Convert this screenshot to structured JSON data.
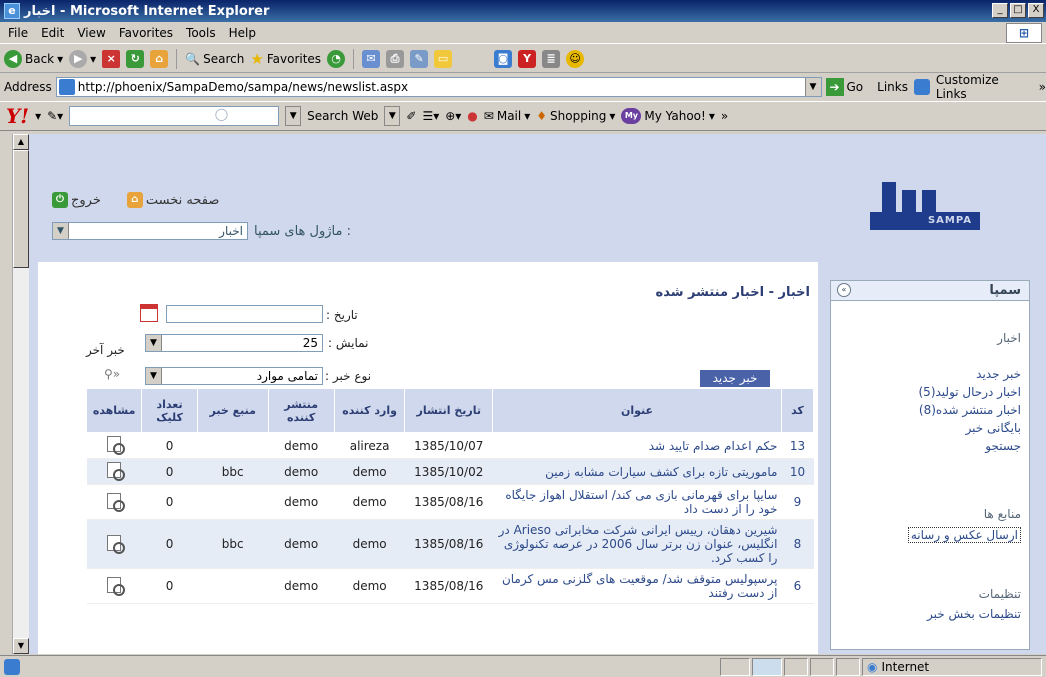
{
  "window": {
    "title": "اخبار - Microsoft Internet Explorer",
    "controls": [
      "_",
      "□",
      "X"
    ]
  },
  "menu": [
    "File",
    "Edit",
    "View",
    "Favorites",
    "Tools",
    "Help"
  ],
  "toolbar": {
    "back": "Back",
    "search": "Search",
    "favorites": "Favorites"
  },
  "address": {
    "label": "Address",
    "url": "http://phoenix/SampaDemo/sampa/news/newslist.aspx",
    "go": "Go",
    "links": "Links",
    "customize": "Customize Links",
    "more": "»"
  },
  "yahoo": {
    "logo": "Y!",
    "search_web": "Search Web",
    "mail": "Mail",
    "shopping": "Shopping",
    "my_yahoo": "My Yahoo!",
    "more": "»"
  },
  "header": {
    "home": "صفحه نخست",
    "logout": "خروج",
    "modules_label": "ماژول های سمپا :",
    "module_selected": "اخبار",
    "logo_text": "SAMPA"
  },
  "main": {
    "page_title": "اخبار - اخبار منتشر شده",
    "date_label": "تاریخ :",
    "show_label": "نمایش :",
    "show_value": "25",
    "last_news": "خبر آخر",
    "type_label": "نوع خبر :",
    "type_value": "تمامی موارد",
    "new_news_button": "خبر جدید"
  },
  "table": {
    "headers": [
      "کد",
      "عنوان",
      "تاریخ انتشار",
      "وارد کننده",
      "منتشر کننده",
      "منبع خبر",
      "تعداد کلیک",
      "مشاهده"
    ],
    "rows": [
      {
        "code": "13",
        "title": "حکم اعدام صدام تایید شد",
        "date": "1385/10/07",
        "entered_by": "alireza",
        "published_by": "demo",
        "source": "",
        "clicks": "0"
      },
      {
        "code": "10",
        "title": "ماموریتی تازه برای کشف سیارات مشابه زمین",
        "date": "1385/10/02",
        "entered_by": "demo",
        "published_by": "demo",
        "source": "bbc",
        "clicks": "0"
      },
      {
        "code": "9",
        "title": "سایپا برای قهرمانی بازی می کند/ استقلال اهواز جایگاه خود را از دست داد",
        "date": "1385/08/16",
        "entered_by": "demo",
        "published_by": "demo",
        "source": "",
        "clicks": "0"
      },
      {
        "code": "8",
        "title": "شیرین دهقان، رییس ایرانی شرکت مخابراتی Arieso در انگلیس، عنوان زن برتر سال 2006 در عرصه تکنولوژی را کسب کرد.",
        "date": "1385/08/16",
        "entered_by": "demo",
        "published_by": "demo",
        "source": "bbc",
        "clicks": "0"
      },
      {
        "code": "6",
        "title": "پرسپولیس متوقف شد/ موقعیت های گلزنی مس کرمان از دست رفتند",
        "date": "1385/08/16",
        "entered_by": "demo",
        "published_by": "demo",
        "source": "",
        "clicks": "0"
      }
    ]
  },
  "sidebar": {
    "title": "سمپا",
    "section_news": "اخبار",
    "news_items": [
      "خبر جدید",
      "اخبار درحال تولید(5)",
      "اخبار منتشر شده(8)",
      "بایگانی خبر",
      "جستجو"
    ],
    "section_sources": "منابع ها",
    "sources_items": [
      "ارسال عکس و رسانه"
    ],
    "section_settings": "تنظیمات",
    "settings_items": [
      "تنظیمات بخش خبر"
    ]
  },
  "status": {
    "zone": "Internet"
  }
}
